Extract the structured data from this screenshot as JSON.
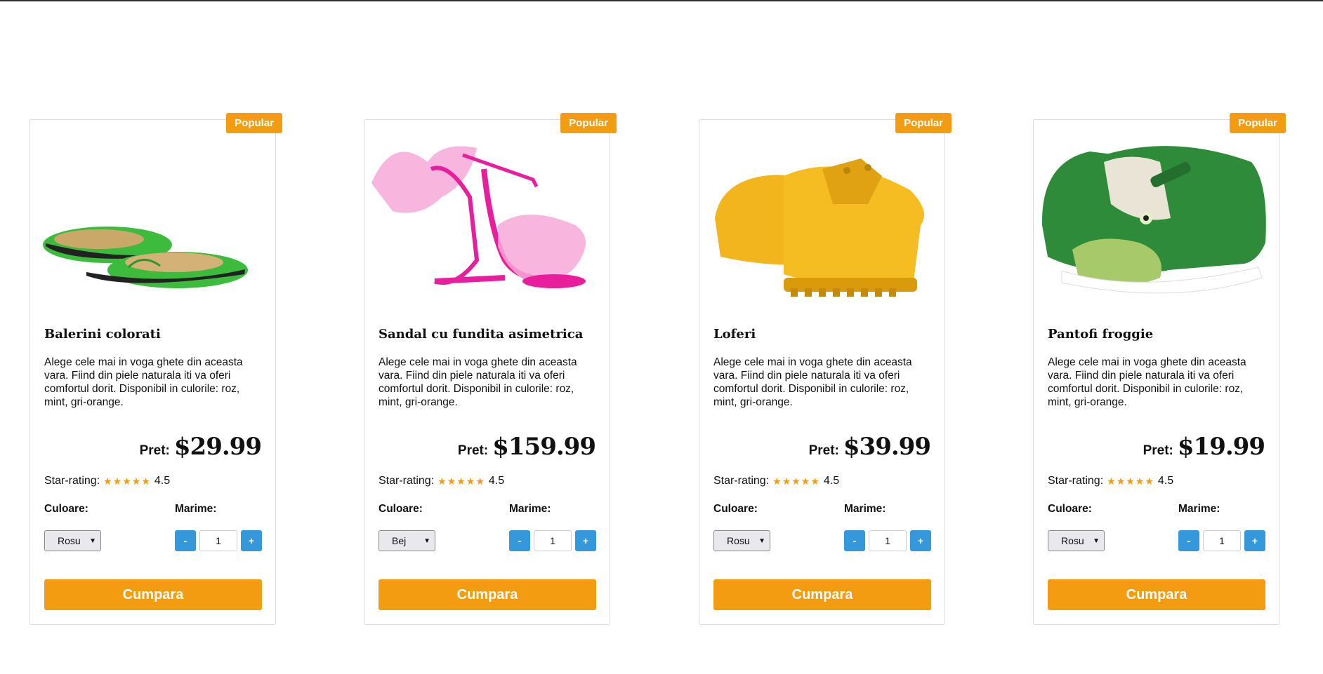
{
  "products": [
    {
      "badge": "Popular",
      "title": "Balerini colorati",
      "description": "Alege cele mai in voga ghete din aceasta vara. Fiind din piele naturala iti va oferi comfortul dorit. Disponibil in culorile: roz, mint, gri-orange.",
      "price_label": "Pret:",
      "price": "$29.99",
      "rating_label": "Star-rating:",
      "stars": "★★★★★",
      "rating": "4.5",
      "color_label": "Culoare:",
      "size_label": "Marime:",
      "color_selected": "Rosu",
      "qty_minus": "-",
      "qty": "1",
      "qty_plus": "+",
      "buy_label": "Cumpara",
      "image_icon": "green-ballet-flats-image"
    },
    {
      "badge": "Popular",
      "title": "Sandal cu fundita asimetrica",
      "description": "Alege cele mai in voga ghete din aceasta vara. Fiind din piele naturala iti va oferi comfortul dorit. Disponibil in culorile: roz, mint, gri-orange.",
      "price_label": "Pret:",
      "price": "$159.99",
      "rating_label": "Star-rating:",
      "stars": "★★★★★",
      "rating": "4.5",
      "color_label": "Culoare:",
      "size_label": "Marime:",
      "color_selected": "Bej",
      "qty_minus": "-",
      "qty": "1",
      "qty_plus": "+",
      "buy_label": "Cumpara",
      "image_icon": "pink-bow-sandals-image"
    },
    {
      "badge": "Popular",
      "title": "Loferi",
      "description": "Alege cele mai in voga ghete din aceasta vara. Fiind din piele naturala iti va oferi comfortul dorit. Disponibil in culorile: roz, mint, gri-orange.",
      "price_label": "Pret:",
      "price": "$39.99",
      "rating_label": "Star-rating:",
      "stars": "★★★★★",
      "rating": "4.5",
      "color_label": "Culoare:",
      "size_label": "Marime:",
      "color_selected": "Rosu",
      "qty_minus": "-",
      "qty": "1",
      "qty_plus": "+",
      "buy_label": "Cumpara",
      "image_icon": "yellow-loafers-image"
    },
    {
      "badge": "Popular",
      "title": "Pantofi froggie",
      "description": "Alege cele mai in voga ghete din aceasta vara. Fiind din piele naturala iti va oferi comfortul dorit. Disponibil in culorile: roz, mint, gri-orange.",
      "price_label": "Pret:",
      "price": "$19.99",
      "rating_label": "Star-rating:",
      "stars": "★★★★★",
      "rating": "4.5",
      "color_label": "Culoare:",
      "size_label": "Marime:",
      "color_selected": "Rosu",
      "qty_minus": "-",
      "qty": "1",
      "qty_plus": "+",
      "buy_label": "Cumpara",
      "image_icon": "green-frog-shoes-image"
    }
  ],
  "colors": {
    "accent_orange": "#f39c12",
    "button_blue": "#3498db"
  }
}
